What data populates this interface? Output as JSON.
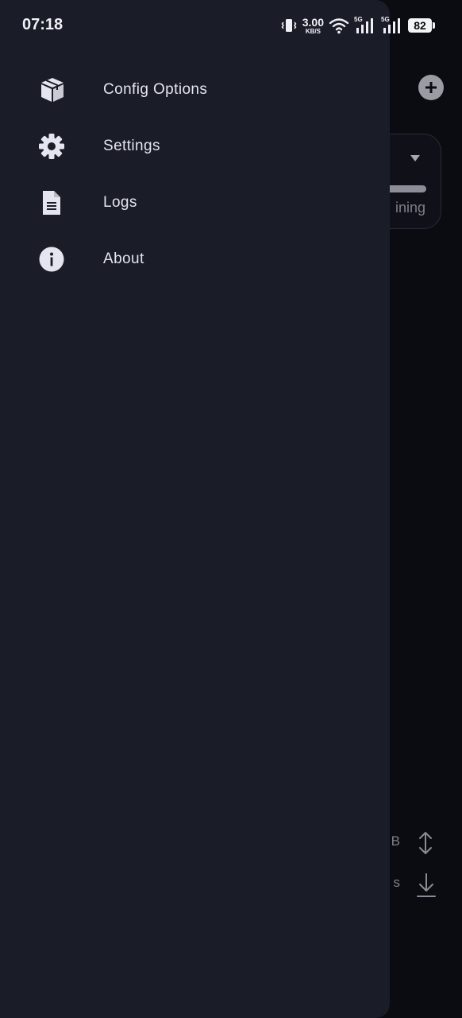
{
  "status_bar": {
    "time": "07:18",
    "speed_value": "3.00",
    "speed_unit": "KB/S",
    "network_1": "5G",
    "network_2": "5G",
    "battery": "82",
    "icons": [
      "vibrate-icon",
      "wifi-icon",
      "signal-icon",
      "signal-icon",
      "battery-icon"
    ]
  },
  "drawer": {
    "items": [
      {
        "label": "Config Options",
        "icon": "package-icon"
      },
      {
        "label": "Settings",
        "icon": "gear-icon"
      },
      {
        "label": "Logs",
        "icon": "document-icon"
      },
      {
        "label": "About",
        "icon": "info-icon"
      }
    ]
  },
  "background": {
    "card_text_fragment": "ining",
    "stat_fragment_1": "B",
    "stat_fragment_2": "s",
    "icons": [
      "add-icon",
      "dropdown-arrow-icon",
      "up-down-arrows-icon",
      "download-arrow-icon"
    ]
  },
  "colors": {
    "drawer_bg": "#1a1c28",
    "screen_bg": "#0b0c11",
    "text": "#e4e5ee",
    "icon": "#e4e5ee"
  }
}
